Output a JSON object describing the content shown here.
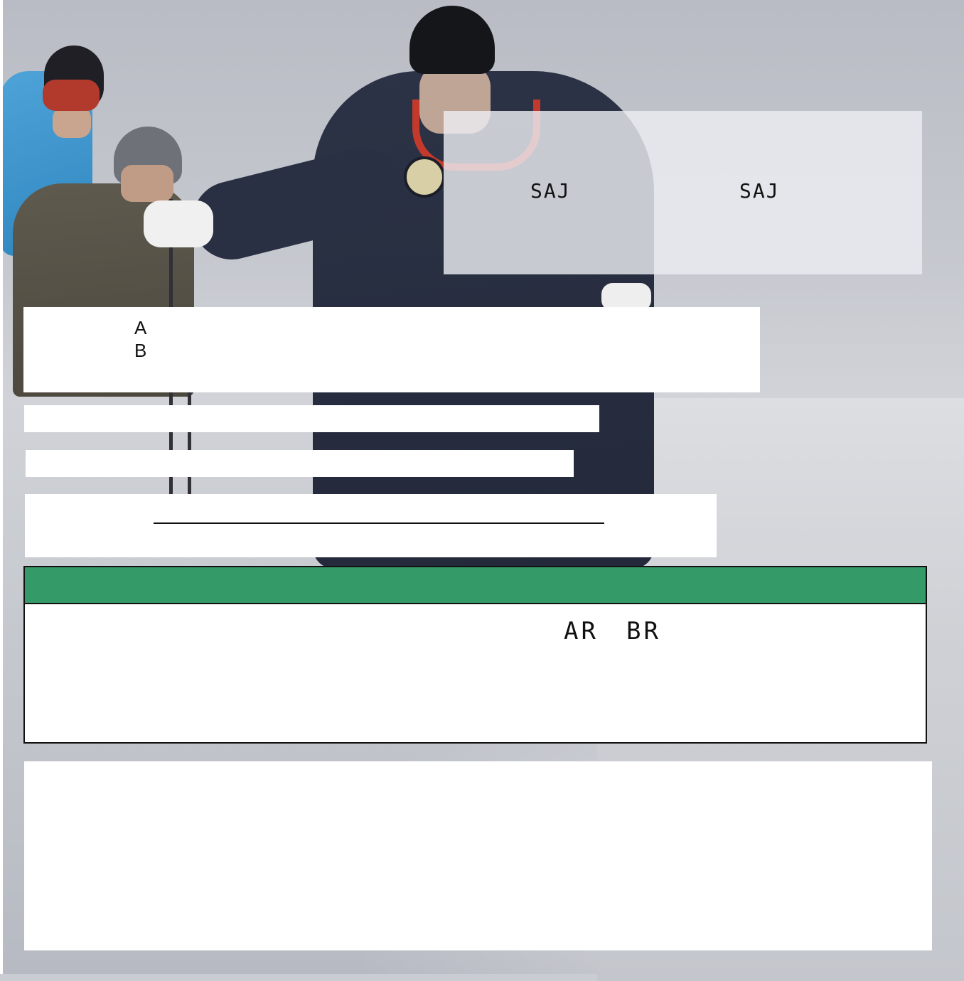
{
  "page": {
    "background": "ski-instructor-photo",
    "accent_color": "#349a68"
  },
  "heading_panel": {
    "left_text": "SAJ",
    "right_text": "SAJ"
  },
  "course_box": {
    "course_a": "A",
    "course_b": "B"
  },
  "level_panel": {
    "header_color": "#349a68",
    "level_ar": "AR",
    "level_br": "BR"
  }
}
